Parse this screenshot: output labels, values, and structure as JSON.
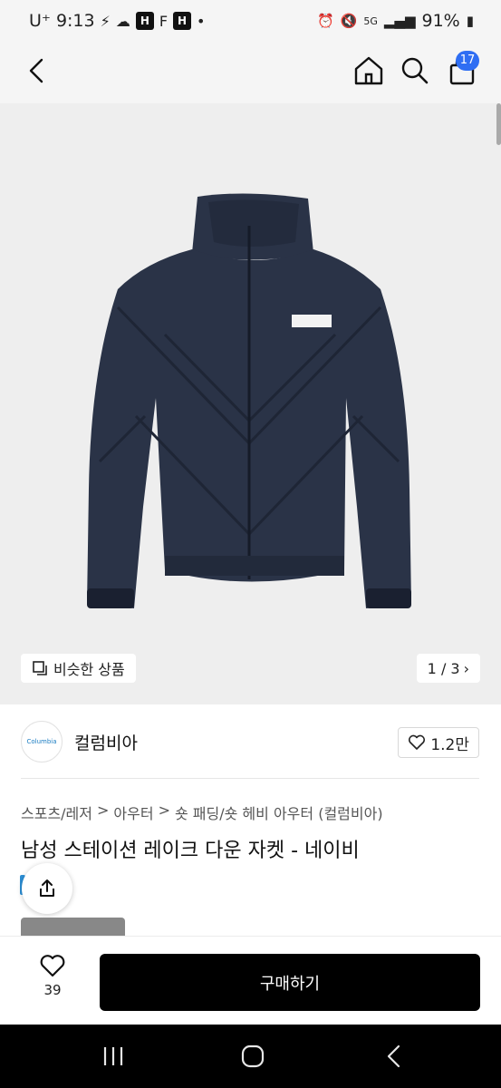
{
  "status_bar": {
    "carrier": "U⁺",
    "time": "9:13",
    "badge_h1": "H",
    "badge_h2": "H",
    "dot": "•",
    "network": "5G",
    "battery": "91%"
  },
  "header": {
    "cart_count": "17",
    "icons": [
      "back-icon",
      "home-icon",
      "search-icon",
      "shopping-bag-icon"
    ]
  },
  "gallery": {
    "similar_label": "비슷한 상품",
    "page_indicator": "1 / 3",
    "brand_patch": "Columbia"
  },
  "brand": {
    "logo_text": "Columbia",
    "name": "컬럼비아",
    "likes": "1.2만"
  },
  "breadcrumb": [
    "스포츠/레저",
    "아우터",
    "숏 패딩/숏 헤비 아우터 (컬럼비아)"
  ],
  "breadcrumb_separator": ">",
  "product": {
    "title": "남성 스테이션 레이크 다운 자켓 - 네이비"
  },
  "bottom_bar": {
    "wish_count": "39",
    "buy_label": "구매하기"
  },
  "colors": {
    "accent_badge": "#2f6ef3",
    "buy_button": "#000000",
    "jacket_navy": "#2a3347"
  }
}
